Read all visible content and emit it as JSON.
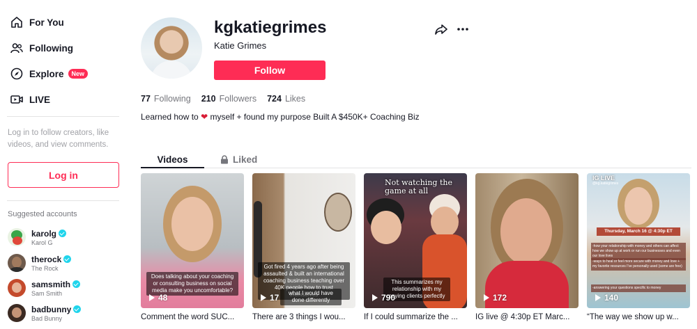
{
  "sidebar": {
    "nav": [
      {
        "label": "For You",
        "icon": "home-icon"
      },
      {
        "label": "Following",
        "icon": "people-icon"
      },
      {
        "label": "Explore",
        "icon": "compass-icon",
        "badge": "New"
      },
      {
        "label": "LIVE",
        "icon": "live-icon"
      }
    ],
    "login_hint": "Log in to follow creators, like videos, and view comments.",
    "login_button": "Log in",
    "suggested_title": "Suggested accounts",
    "accounts": [
      {
        "handle": "karolg",
        "name": "Karol G"
      },
      {
        "handle": "therock",
        "name": "The Rock"
      },
      {
        "handle": "samsmith",
        "name": "Sam Smith"
      },
      {
        "handle": "badbunny",
        "name": "Bad Bunny"
      }
    ]
  },
  "profile": {
    "username": "kgkatiegrimes",
    "name": "Katie Grimes",
    "follow_label": "Follow",
    "stats": [
      {
        "num": "77",
        "label": "Following"
      },
      {
        "num": "210",
        "label": "Followers"
      },
      {
        "num": "724",
        "label": "Likes"
      }
    ],
    "bio_before": "Learned how to",
    "bio_after": "myself + found my purpose Built A $450K+ Coaching Biz"
  },
  "tabs": {
    "videos": "Videos",
    "liked": "Liked"
  },
  "videos": [
    {
      "views": "48",
      "caption": "Comment the word SUC...",
      "overlay": "Does talking about your coaching or consulting business on social media make you uncomfortable?"
    },
    {
      "views": "17",
      "caption": "There are 3 things I wou...",
      "overlay": "Got fired 4 years ago after being assaulted & built an international coaching business teaching over 40K people how to trust themselves",
      "overlay2": "what I would have done differently"
    },
    {
      "views": "790",
      "caption": "If I could summarize the ...",
      "overlay": "This summarizes my relationship with my paying clients perfectly",
      "top_text": "Not watching the game at all"
    },
    {
      "views": "172",
      "caption": "IG live @ 4:30p ET Marc..."
    },
    {
      "views": "140",
      "caption": "“The way we show up w...",
      "overlay": "Thursday, March 16 @ 4:30p ET",
      "top_text": "IG LIVE",
      "handle": "@kg.katiegrimes",
      "bullets": "-how your relationship with money and others can affect how we show up at work or run our businesses and even our love lives",
      "bullets2": "-ways to heal or feel more secure with money and love + my favorite resources I've personally used (some are free)",
      "bullets3": "-answering your questions specific to money"
    }
  ],
  "colors": {
    "accent": "#fe2c55",
    "verified": "#20d5ec"
  }
}
